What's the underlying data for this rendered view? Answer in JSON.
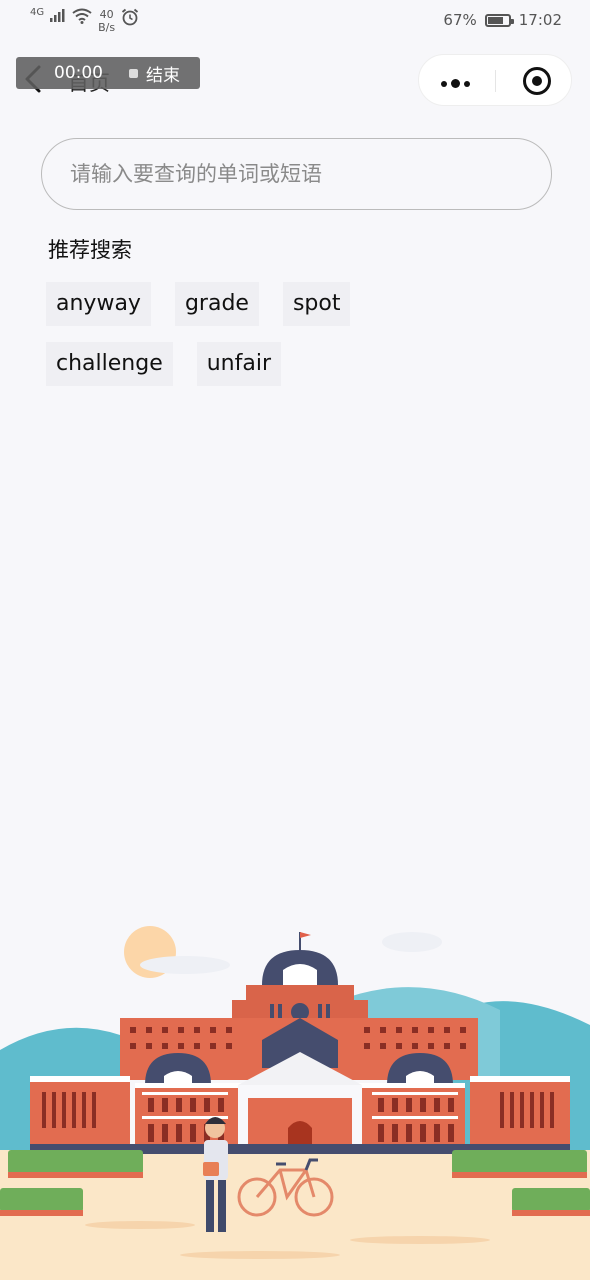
{
  "status_bar": {
    "signal": "4G",
    "net_speed_value": "40",
    "net_speed_unit": "B/s",
    "battery": "67%",
    "battery_level": 0.67,
    "time": "17:02"
  },
  "nav": {
    "title": "首页",
    "recording_time": "00:00",
    "recording_stop_label": "结束"
  },
  "search": {
    "placeholder": "请输入要查询的单词或短语",
    "value": ""
  },
  "recommend": {
    "title": "推荐搜索",
    "tags": [
      "anyway",
      "grade",
      "spot",
      "challenge",
      "unfair"
    ]
  },
  "colors": {
    "background": "#f7f7fa",
    "tag_bg": "#efeff3",
    "building_red": "#d9644a",
    "roof_navy": "#454d6e",
    "hill_teal": "#5fbccd",
    "ground": "#fbe7c8"
  }
}
